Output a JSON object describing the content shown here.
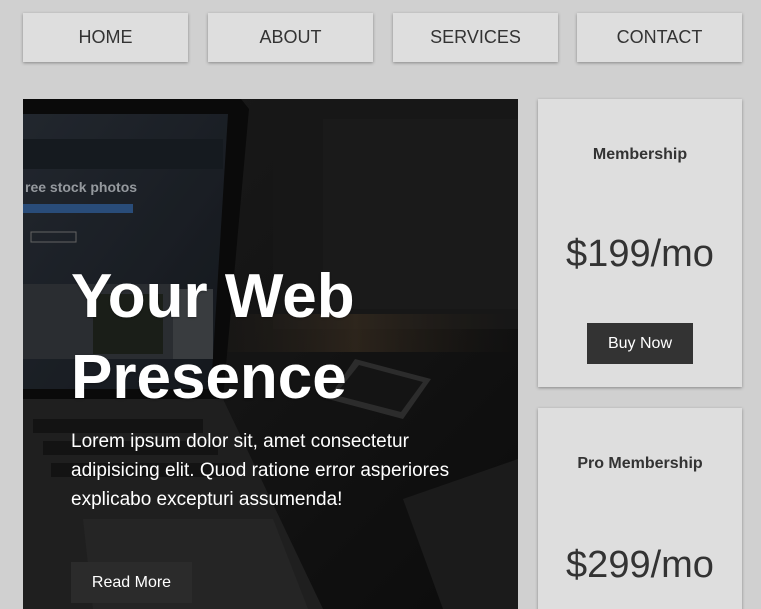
{
  "nav": {
    "items": [
      {
        "label": "HOME"
      },
      {
        "label": "ABOUT"
      },
      {
        "label": "SERVICES"
      },
      {
        "label": "CONTACT"
      }
    ]
  },
  "hero": {
    "title_line1": "Your Web",
    "title_line2": "Presence",
    "text": "Lorem ipsum dolor sit, amet consectetur adipisicing elit. Quod ratione error asperiores explicabo excepturi assumenda!",
    "button_label": "Read More",
    "image_text": "ree stock photos"
  },
  "cards": [
    {
      "title": "Membership",
      "price": "$199/mo",
      "button_label": "Buy Now"
    },
    {
      "title": "Pro Membership",
      "price": "$299/mo"
    }
  ]
}
